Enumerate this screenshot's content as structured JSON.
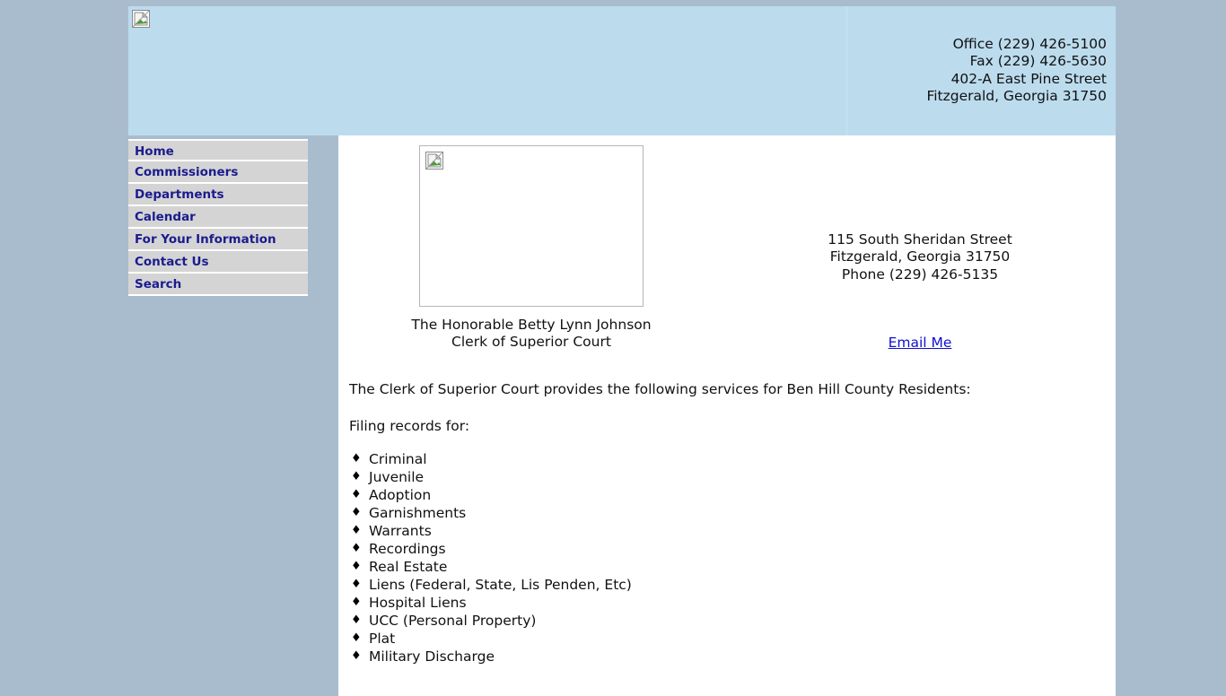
{
  "header": {
    "logo_alt": "broken-image",
    "contact_lines": [
      "Office (229) 426-5100",
      "Fax (229) 426-5630",
      "402-A East Pine Street",
      "Fitzgerald, Georgia 31750"
    ]
  },
  "nav": {
    "items": [
      {
        "label": "Home"
      },
      {
        "label": "Commissioners"
      },
      {
        "label": "Departments"
      },
      {
        "label": "Calendar"
      },
      {
        "label": "For Your Information"
      },
      {
        "label": "Contact Us"
      },
      {
        "label": "Search"
      }
    ]
  },
  "main": {
    "photo": {
      "alt": "broken-image",
      "caption_line1": "The Honorable Betty Lynn Johnson",
      "caption_line2": "Clerk of Superior Court"
    },
    "office": {
      "address_lines": [
        "115 South Sheridan Street",
        "Fitzgerald, Georgia 31750",
        "Phone (229) 426-5135"
      ],
      "email_link_label": "Email Me"
    },
    "intro_paragraph": "The Clerk of Superior Court provides the following services for Ben Hill County Residents:",
    "list_heading": "Filing records for:",
    "bullet_glyph": "♦",
    "services": [
      "Criminal",
      "Juvenile",
      "Adoption",
      "Garnishments",
      "Warrants",
      "Recordings",
      "Real Estate",
      "Liens (Federal, State, Lis Penden, Etc)",
      "Hospital Liens",
      "UCC (Personal Property)",
      "Plat",
      "Military Discharge"
    ]
  },
  "colors": {
    "page_background": "#a9bcce",
    "header_blue": "#bcdcee",
    "nav_gray": "#d4d4d4",
    "nav_text": "#1b1b8f",
    "link_blue": "#1010cf",
    "content_white": "#ffffff"
  }
}
